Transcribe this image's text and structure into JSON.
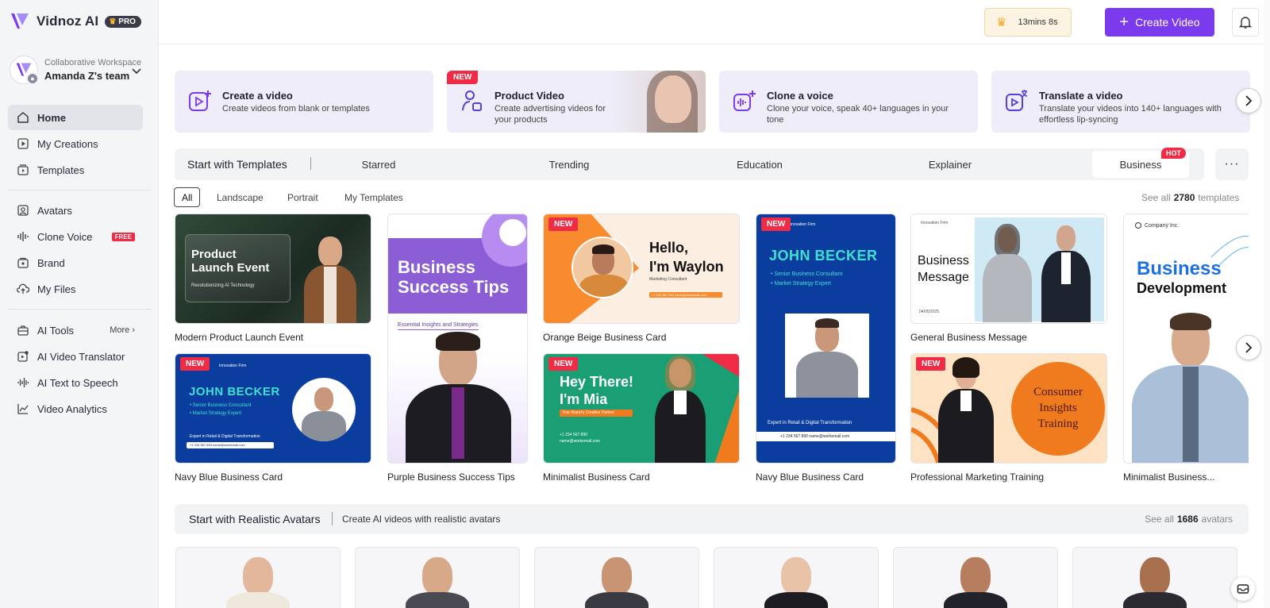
{
  "brand": {
    "name": "Vidnoz AI",
    "badge": "PRO"
  },
  "workspace": {
    "label": "Collaborative Workspace",
    "team": "Amanda Z's team"
  },
  "nav": [
    {
      "label": "Home"
    },
    {
      "label": "My Creations"
    },
    {
      "label": "Templates"
    },
    {
      "label": "Avatars"
    },
    {
      "label": "Clone Voice",
      "tag": "FREE"
    },
    {
      "label": "Brand"
    },
    {
      "label": "My Files"
    },
    {
      "label": "AI Tools",
      "more": "More"
    },
    {
      "label": "AI Video Translator"
    },
    {
      "label": "AI Text to Speech"
    },
    {
      "label": "Video Analytics"
    }
  ],
  "topbar": {
    "timer": "13mins 8s",
    "create": "Create Video"
  },
  "features": [
    {
      "title": "Create a video",
      "desc": "Create videos from blank or templates"
    },
    {
      "title": "Product Video",
      "desc": "Create advertising videos for your products",
      "tag": "NEW"
    },
    {
      "title": "Clone a voice",
      "desc": "Clone your voice, speak 40+ languages in your tone"
    },
    {
      "title": "Translate a video",
      "desc": "Translate your videos into 140+ languages with effortless lip-syncing"
    }
  ],
  "templates": {
    "title": "Start with Templates",
    "tabs": [
      "Starred",
      "Trending",
      "Education",
      "Explainer",
      "Business"
    ],
    "hot": "HOT",
    "filters": [
      "All",
      "Landscape",
      "Portrait",
      "My Templates"
    ],
    "see_all": "See all",
    "count": "2780",
    "unit": "templates",
    "new_tag": "NEW",
    "cards": [
      {
        "caption": "Modern Product Launch Event",
        "l1": "Product",
        "l2": "Launch Event",
        "sub": "Revolutionizing AI Technology"
      },
      {
        "caption": "Navy Blue Business Card",
        "name": "JOHN BECKER",
        "b1": "Senior Business Consultant",
        "b2": "Market Strategy Expert",
        "foot": "Expert in Retail & Digital Transformation",
        "brand": "Innovation Firm",
        "contact": "+1 234 567 890   name@workemail.com"
      },
      {
        "caption": "Purple Business Success Tips",
        "l1": "Business",
        "l2": "Success Tips",
        "sub": "Essential Insights and Strategies"
      },
      {
        "caption": "Orange Beige Business Card",
        "l1": "Hello,",
        "l2": "I'm Waylon",
        "sub": "Marketing Consultant",
        "contact": "+1 234 567 890   name@workemail.com"
      },
      {
        "caption": "Minimalist Business Card",
        "l1": "Hey There!",
        "l2": "I'm Mia",
        "sub": "Your Brand's Creative Partner",
        "contact": "+1 234 567 890\nname@workemail.com"
      },
      {
        "caption": "Navy Blue Business Card",
        "name": "JOHN BECKER",
        "b1": "Senior Business Consultant",
        "b2": "Market Strategy Expert",
        "foot": "Expert in Retail & Digital Transformation",
        "brand": "Innovation Firm",
        "contact": "+1 234 567 890   name@workemail.com"
      },
      {
        "caption": "General Business Message",
        "l1": "Business",
        "l2": "Message",
        "brand": "Innovation Firm",
        "date": "04/05/2025"
      },
      {
        "caption": "Professional Marketing Training",
        "l1": "Consumer",
        "l2": "Insights",
        "l3": "Training"
      },
      {
        "caption": "Minimalist Business...",
        "l1": "Business",
        "l2": "Development",
        "brand": "Company Inc."
      }
    ]
  },
  "avatars": {
    "title": "Start with Realistic Avatars",
    "desc": "Create AI videos with realistic avatars",
    "see_all": "See all",
    "count": "1686",
    "unit": "avatars"
  },
  "colors": {
    "accent": "#7c3aed",
    "new": "#ef2b45",
    "navy": "#0a3d9e"
  }
}
